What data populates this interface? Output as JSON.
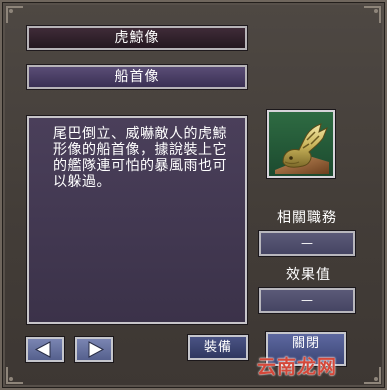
{
  "item": {
    "name": "虎鯨像",
    "type": "船首像",
    "description": "尾巴倒立、威嚇敵人的虎鯨形像的船首像，據說裝上它的艦隊連可怕的暴風雨也可以躲過。"
  },
  "side_panel": {
    "related_duty_label": "相關職務",
    "related_duty_value": "—",
    "effect_label": "效果值",
    "effect_value": "—"
  },
  "buttons": {
    "prev_icon": "left-arrow-icon",
    "next_icon": "right-arrow-icon",
    "equip_label": "裝備",
    "close_label": "關閉"
  },
  "watermark": "云南龙网",
  "colors": {
    "panel": "#433d38",
    "title_bar": "#3f2b38",
    "subtitle_bar": "#4a3f6a",
    "description_bg": "#433853",
    "field_bg": "#4f4e6c",
    "button_bg": "#4a5384",
    "watermark": "#d4483a"
  }
}
